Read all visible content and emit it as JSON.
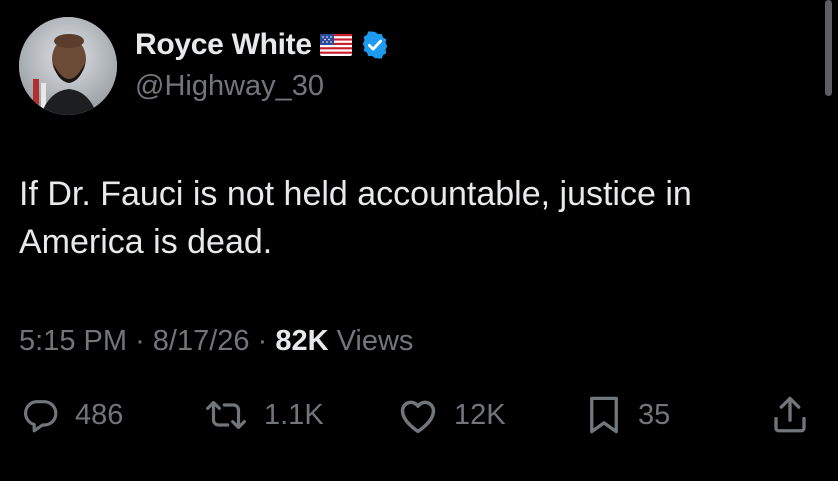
{
  "author": {
    "display_name": "Royce White",
    "handle": "@Highway_30"
  },
  "tweet": {
    "text": "If Dr. Fauci is not held accountable, justice in America is dead.",
    "time": "5:15 PM",
    "date": "8/17/26",
    "views_count": "82K",
    "views_label": "Views"
  },
  "actions": {
    "replies": "486",
    "reposts": "1.1K",
    "likes": "12K",
    "bookmarks": "35"
  },
  "icons": [
    "flag-icon",
    "verified-icon",
    "reply-icon",
    "repost-icon",
    "like-icon",
    "bookmark-icon",
    "share-icon"
  ],
  "colors": {
    "background": "#000000",
    "primary_text": "#e7e9ea",
    "secondary_text": "#71767b",
    "verified_blue": "#1d9bf0"
  }
}
